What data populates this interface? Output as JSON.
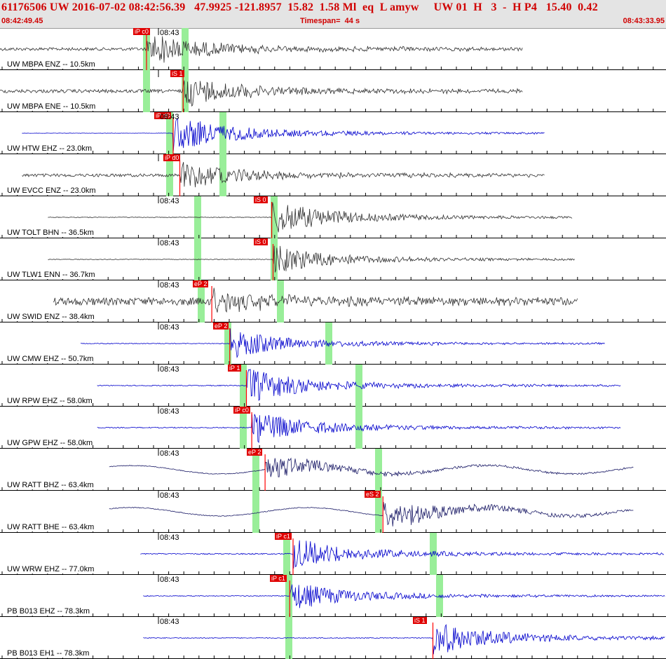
{
  "header": {
    "title": "61176506 UW 2016-07-02 08:42:56.39   47.9925 -121.8957  15.82  1.58 Ml  eq  L amyw     UW 01  H   3  -  H P4   15.40  0.42",
    "start_time": "08:42:49.45",
    "timespan": "Timespan=  44 s",
    "end_time": "08:43:33.95"
  },
  "colors": {
    "header_bg": "#e4e4e4",
    "header_text": "#d00000",
    "trace_gray": "#303030",
    "trace_blue": "#0000cc",
    "trace_navy": "#1a1a66",
    "pick_box": "#e00000",
    "window_band": "#99ee99",
    "pick_marker": "#ff0000"
  },
  "minute_label": "08:43",
  "traces": [
    {
      "label": "UW MBPA ENZ -- 10.5km",
      "color": "gray",
      "show_time": true,
      "pick": "iP c0",
      "pick_pos": 0.2,
      "onset": 0.22,
      "bands": [
        0.22,
        0.278
      ],
      "start": 0.0,
      "end": 0.785,
      "noise": 0.18,
      "amp": 0.8
    },
    {
      "label": "UW MBPA ENE -- 10.5km",
      "color": "gray",
      "show_time": false,
      "pick": "iS 1",
      "pick_pos": 0.256,
      "onset": 0.275,
      "bands": [
        0.22,
        0.278
      ],
      "start": 0.0,
      "end": 0.785,
      "noise": 0.2,
      "amp": 0.75
    },
    {
      "label": "UW HTW EHZ -- 23.0km",
      "color": "blue",
      "show_time": true,
      "pick": "iP d0",
      "pick_pos": 0.232,
      "onset": 0.26,
      "bands": [
        0.255,
        0.335
      ],
      "start": 0.033,
      "end": 0.818,
      "noise": 0.02,
      "amp": 0.9
    },
    {
      "label": "UW EVCC ENZ -- 23.0km",
      "color": "gray",
      "show_time": false,
      "pick": "iP d0",
      "pick_pos": 0.245,
      "onset": 0.27,
      "bands": [
        0.255,
        0.335
      ],
      "start": 0.033,
      "end": 0.818,
      "noise": 0.18,
      "amp": 0.7
    },
    {
      "label": "UW TOLT BHN -- 36.5km",
      "color": "gray",
      "show_time": true,
      "pick": "iS 0",
      "pick_pos": 0.381,
      "onset": 0.408,
      "bands": [
        0.297,
        0.412
      ],
      "start": 0.072,
      "end": 0.86,
      "noise": 0.04,
      "amp": 0.85
    },
    {
      "label": "UW TLW1 ENN -- 36.7km",
      "color": "gray",
      "show_time": true,
      "pick": "iS 0",
      "pick_pos": 0.381,
      "onset": 0.41,
      "bands": [
        0.297,
        0.412
      ],
      "start": 0.072,
      "end": 0.863,
      "noise": 0.04,
      "amp": 0.7
    },
    {
      "label": "UW SWID ENZ -- 38.4km",
      "color": "gray",
      "show_time": true,
      "pick": "eP 2",
      "pick_pos": 0.289,
      "onset": 0.318,
      "bands": [
        0.302,
        0.421
      ],
      "start": 0.08,
      "end": 0.867,
      "noise": 0.45,
      "amp": 0.6
    },
    {
      "label": "UW CMW EHZ -- 50.7km",
      "color": "blue",
      "show_time": true,
      "pick": "eP 2",
      "pick_pos": 0.32,
      "onset": 0.345,
      "bands": [
        0.342,
        0.494
      ],
      "start": 0.121,
      "end": 0.908,
      "noise": 0.05,
      "amp": 0.7
    },
    {
      "label": "UW RPW EHZ -- 58.0km",
      "color": "blue",
      "show_time": true,
      "pick": "iP 1",
      "pick_pos": 0.342,
      "onset": 0.37,
      "bands": [
        0.365,
        0.539
      ],
      "start": 0.146,
      "end": 0.932,
      "noise": 0.06,
      "amp": 0.85
    },
    {
      "label": "UW GPW EHZ -- 58.0km",
      "color": "blue",
      "show_time": true,
      "pick": "iP c0",
      "pick_pos": 0.35,
      "onset": 0.378,
      "bands": [
        0.365,
        0.539
      ],
      "start": 0.146,
      "end": 0.932,
      "noise": 0.06,
      "amp": 0.8
    },
    {
      "label": "UW RATT BHZ -- 63.4km",
      "color": "navy",
      "show_time": true,
      "pick": "eP 2",
      "pick_pos": 0.37,
      "onset": 0.398,
      "bands": [
        0.384,
        0.568
      ],
      "start": 0.164,
      "end": 0.951,
      "noise": 0.05,
      "amp": 0.6
    },
    {
      "label": "UW RATT BHE -- 63.4km",
      "color": "navy",
      "show_time": true,
      "pick": "eS 2",
      "pick_pos": 0.547,
      "onset": 0.575,
      "bands": [
        0.384,
        0.568
      ],
      "start": 0.164,
      "end": 0.951,
      "noise": 0.05,
      "amp": 0.75
    },
    {
      "label": "UW WRW EHZ -- 77.0km",
      "color": "blue",
      "show_time": true,
      "pick": "iP c1",
      "pick_pos": 0.413,
      "onset": 0.44,
      "bands": [
        0.43,
        0.65
      ],
      "start": 0.211,
      "end": 0.997,
      "noise": 0.07,
      "amp": 0.75
    },
    {
      "label": "PB B013 EHZ -- 78.3km",
      "color": "blue",
      "show_time": true,
      "pick": "iP c1",
      "pick_pos": 0.405,
      "onset": 0.435,
      "bands": [
        0.434,
        0.66
      ],
      "start": 0.215,
      "end": 1.0,
      "noise": 0.05,
      "amp": 0.7
    },
    {
      "label": "PB B013 EH1 -- 78.3km",
      "color": "blue",
      "show_time": true,
      "pick": "iS 1",
      "pick_pos": 0.62,
      "onset": 0.65,
      "bands": [
        0.434
      ],
      "start": 0.215,
      "end": 1.0,
      "noise": 0.05,
      "amp": 0.85
    }
  ]
}
